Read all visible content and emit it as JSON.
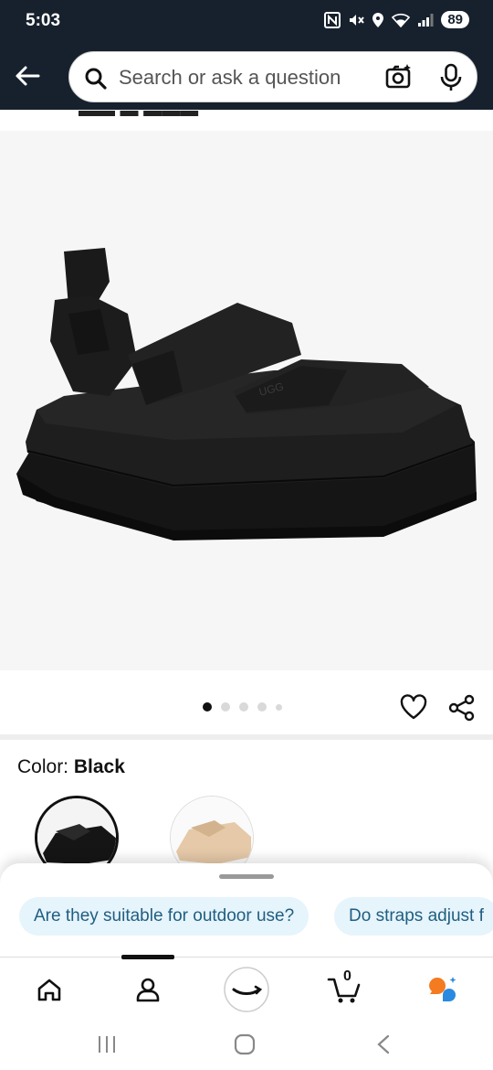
{
  "status_bar": {
    "time": "5:03",
    "battery": "89"
  },
  "search": {
    "placeholder": "Search or ask a question"
  },
  "product": {
    "color_label": "Color:",
    "color_value": "Black",
    "image_count": 5,
    "active_image_index": 0
  },
  "suggestions": [
    {
      "label": "Are they suitable for outdoor use?"
    },
    {
      "label": "Do straps adjust f"
    }
  ],
  "bottom_nav": {
    "cart_count": "0",
    "active_tab": "account"
  },
  "colors": {
    "header_bg": "#17212e",
    "chip_bg": "#e6f4fb",
    "chip_text": "#1f5e82",
    "rufus_orange": "#f47b20",
    "rufus_blue": "#2b8ae0"
  }
}
